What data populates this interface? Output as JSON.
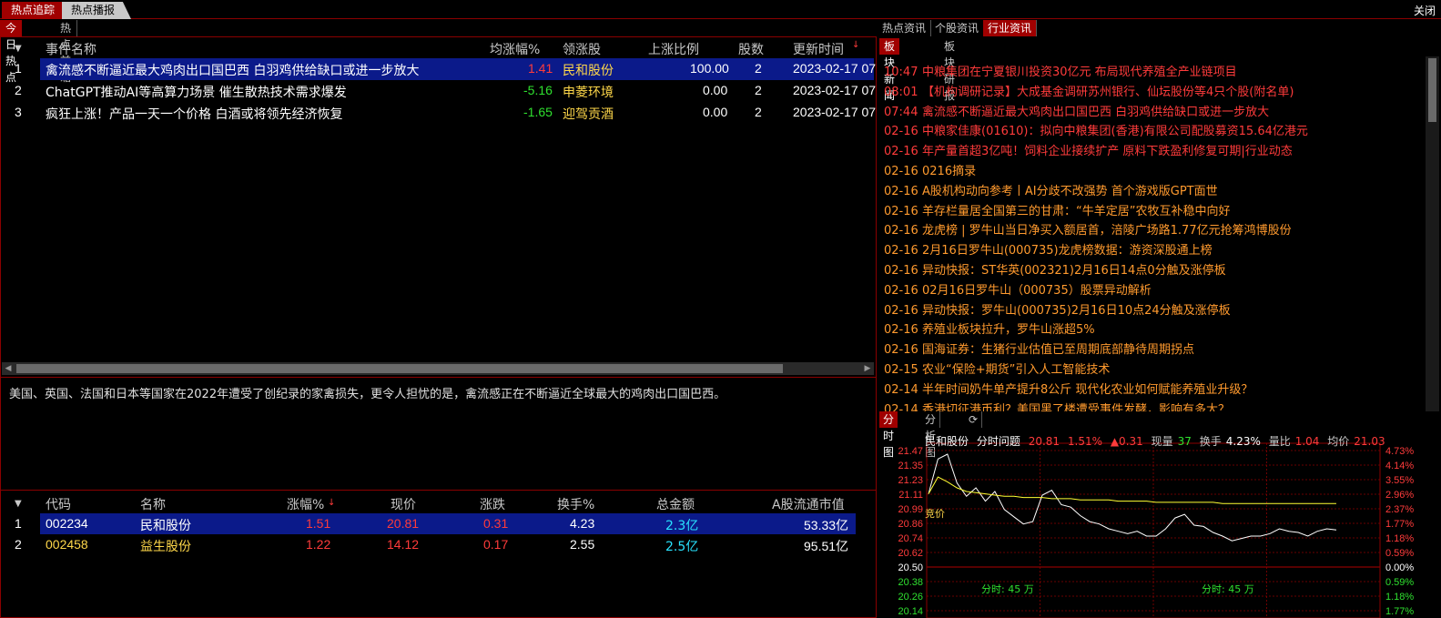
{
  "top_tabs": {
    "active": "热点追踪",
    "inactive": "热点播报",
    "close": "关闭"
  },
  "left_subtabs": {
    "active": "今日热点",
    "inactive": "热点前瞻"
  },
  "events": {
    "headers": [
      "事件名称",
      "均涨幅%",
      "领涨股",
      "上涨比例",
      "股数",
      "更新时间"
    ],
    "rows": [
      {
        "idx": "1",
        "name": "禽流感不断逼近最大鸡肉出口国巴西 白羽鸡供给缺口或进一步放大",
        "avg": "1.41",
        "lead": "民和股份",
        "ratio": "100.00",
        "count": "2",
        "time": "2023-02-17 07"
      },
      {
        "idx": "2",
        "name": "ChatGPT推动AI等高算力场景 催生散热技术需求爆发",
        "avg": "-5.16",
        "lead": "申菱环境",
        "ratio": "0.00",
        "count": "2",
        "time": "2023-02-17 07"
      },
      {
        "idx": "3",
        "name": "疯狂上涨！产品一天一个价格 白酒或将领先经济恢复",
        "avg": "-1.65",
        "lead": "迎驾贡酒",
        "ratio": "0.00",
        "count": "2",
        "time": "2023-02-17 07"
      }
    ]
  },
  "description": "美国、英国、法国和日本等国家在2022年遭受了创纪录的家禽损失，更令人担忧的是，禽流感正在不断逼近全球最大的鸡肉出口国巴西。",
  "stocks": {
    "headers": [
      "代码",
      "名称",
      "涨幅%",
      "现价",
      "涨跌",
      "换手%",
      "总金额",
      "A股流通市值"
    ],
    "rows": [
      {
        "idx": "1",
        "code": "002234",
        "name": "民和股份",
        "pct": "1.51",
        "price": "20.81",
        "chg": "0.31",
        "turnover": "4.23",
        "amount": "2.3亿",
        "mcap": "53.33亿"
      },
      {
        "idx": "2",
        "code": "002458",
        "name": "益生股份",
        "pct": "1.22",
        "price": "14.12",
        "chg": "0.17",
        "turnover": "2.55",
        "amount": "2.5亿",
        "mcap": "95.51亿"
      }
    ]
  },
  "right_tabs": [
    "热点资讯",
    "个股资讯",
    "行业资讯"
  ],
  "right_subtabs": [
    "板块新闻",
    "板块研报"
  ],
  "news": [
    {
      "time": "10:47",
      "title": "中粮集团在宁夏银川投资30亿元 布局现代养殖全产业链项目"
    },
    {
      "time": "08:01",
      "title": "【机构调研记录】大成基金调研苏州银行、仙坛股份等4只个股(附名单)"
    },
    {
      "time": "07:44",
      "title": "禽流感不断逼近最大鸡肉出口国巴西 白羽鸡供给缺口或进一步放大"
    },
    {
      "time": "02-16",
      "title": "中粮家佳康(01610)：拟向中粮集团(香港)有限公司配股募资15.64亿港元"
    },
    {
      "time": "02-16",
      "title": "年产量首超3亿吨！饲料企业接续扩产 原料下跌盈利修复可期|行业动态"
    },
    {
      "time": "02-16",
      "title": "0216摘录"
    },
    {
      "time": "02-16",
      "title": "A股机构动向参考丨AI分歧不改强势 首个游戏版GPT面世"
    },
    {
      "time": "02-16",
      "title": "羊存栏量居全国第三的甘肃：“牛羊定居”农牧互补稳中向好"
    },
    {
      "time": "02-16",
      "title": "龙虎榜 | 罗牛山当日净买入额居首，涪陵广场路1.77亿元抢筹鸿博股份"
    },
    {
      "time": "02-16",
      "title": "2月16日罗牛山(000735)龙虎榜数据：游资深股通上榜"
    },
    {
      "time": "02-16",
      "title": "异动快报：ST华英(002321)2月16日14点0分触及涨停板"
    },
    {
      "time": "02-16",
      "title": "02月16日罗牛山（000735）股票异动解析"
    },
    {
      "time": "02-16",
      "title": "异动快报：罗牛山(000735)2月16日10点24分触及涨停板"
    },
    {
      "time": "02-16",
      "title": "养殖业板块拉升，罗牛山涨超5%"
    },
    {
      "time": "02-16",
      "title": "国海证券：生猪行业估值已至周期底部静待周期拐点"
    },
    {
      "time": "02-15",
      "title": "农业“保险+期货”引入人工智能技术"
    },
    {
      "time": "02-14",
      "title": "半年时间奶牛单产提升8公斤 现代化农业如何赋能养殖业升级？"
    },
    {
      "time": "02-14",
      "title": "香港切征港币利？美国黑了楼遭受事件发酵，影响有多大？"
    }
  ],
  "chart_tabs": [
    "分时图",
    "分析图"
  ],
  "chart_info": {
    "stock": "民和股份",
    "mode": "分时问题",
    "price": "20.81",
    "pct": "1.51%",
    "chg": "▲0.31",
    "vol_label": "现量",
    "vol": "37",
    "turn_label": "换手",
    "turn": "4.23%",
    "lb_label": "量比",
    "lb": "1.04",
    "avg_label": "均价",
    "avg": "21.03"
  },
  "chart_marks": {
    "jingjia": "竞价",
    "vol1": "分时: 45 万",
    "vol2": "分时: 45 万"
  },
  "chart_data": {
    "type": "line",
    "price_ticks": [
      "21.47",
      "21.35",
      "21.23",
      "21.11",
      "20.99",
      "20.86",
      "20.74",
      "20.62",
      "20.50",
      "20.38",
      "20.26",
      "20.14"
    ],
    "pct_ticks": [
      "4.73%",
      "4.14%",
      "3.55%",
      "2.96%",
      "2.37%",
      "1.77%",
      "1.18%",
      "0.59%",
      "0.00%",
      "0.59%",
      "1.18%",
      "1.77%"
    ],
    "ylim": [
      20.14,
      21.47
    ],
    "base": 20.5,
    "series": [
      {
        "name": "价格",
        "values": [
          21.11,
          21.4,
          21.44,
          21.2,
          21.09,
          21.16,
          21.05,
          21.13,
          20.98,
          20.92,
          20.86,
          20.88,
          21.1,
          21.14,
          21.02,
          21.0,
          20.93,
          20.88,
          20.86,
          20.82,
          20.8,
          20.78,
          20.8,
          20.76,
          20.76,
          20.82,
          20.91,
          20.94,
          20.85,
          20.84,
          20.79,
          20.76,
          20.72,
          20.74,
          20.76,
          20.76,
          20.78,
          20.82,
          20.8,
          20.79,
          20.76,
          20.8,
          20.82,
          20.81
        ]
      },
      {
        "name": "均价",
        "values": [
          21.11,
          21.25,
          21.21,
          21.16,
          21.13,
          21.12,
          21.11,
          21.1,
          21.09,
          21.09,
          21.08,
          21.08,
          21.08,
          21.07,
          21.07,
          21.07,
          21.06,
          21.06,
          21.06,
          21.06,
          21.05,
          21.05,
          21.05,
          21.05,
          21.04,
          21.04,
          21.04,
          21.04,
          21.04,
          21.04,
          21.04,
          21.03,
          21.03,
          21.03,
          21.03,
          21.03,
          21.03,
          21.03,
          21.03,
          21.03,
          21.03,
          21.03,
          21.03,
          21.03
        ]
      }
    ],
    "colors": {
      "price": "#ffffff",
      "avg": "#ffff33",
      "grid": "#8b0000"
    }
  }
}
